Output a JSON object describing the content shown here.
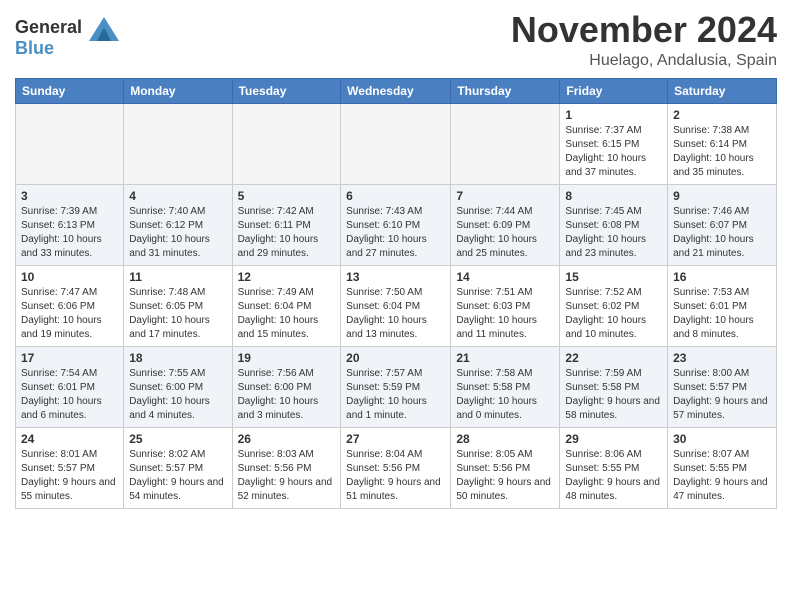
{
  "header": {
    "logo_line1": "General",
    "logo_line2": "Blue",
    "month_title": "November 2024",
    "location": "Huelago, Andalusia, Spain"
  },
  "weekdays": [
    "Sunday",
    "Monday",
    "Tuesday",
    "Wednesday",
    "Thursday",
    "Friday",
    "Saturday"
  ],
  "weeks": [
    [
      {
        "day": "",
        "info": ""
      },
      {
        "day": "",
        "info": ""
      },
      {
        "day": "",
        "info": ""
      },
      {
        "day": "",
        "info": ""
      },
      {
        "day": "",
        "info": ""
      },
      {
        "day": "1",
        "info": "Sunrise: 7:37 AM\nSunset: 6:15 PM\nDaylight: 10 hours and 37 minutes."
      },
      {
        "day": "2",
        "info": "Sunrise: 7:38 AM\nSunset: 6:14 PM\nDaylight: 10 hours and 35 minutes."
      }
    ],
    [
      {
        "day": "3",
        "info": "Sunrise: 7:39 AM\nSunset: 6:13 PM\nDaylight: 10 hours and 33 minutes."
      },
      {
        "day": "4",
        "info": "Sunrise: 7:40 AM\nSunset: 6:12 PM\nDaylight: 10 hours and 31 minutes."
      },
      {
        "day": "5",
        "info": "Sunrise: 7:42 AM\nSunset: 6:11 PM\nDaylight: 10 hours and 29 minutes."
      },
      {
        "day": "6",
        "info": "Sunrise: 7:43 AM\nSunset: 6:10 PM\nDaylight: 10 hours and 27 minutes."
      },
      {
        "day": "7",
        "info": "Sunrise: 7:44 AM\nSunset: 6:09 PM\nDaylight: 10 hours and 25 minutes."
      },
      {
        "day": "8",
        "info": "Sunrise: 7:45 AM\nSunset: 6:08 PM\nDaylight: 10 hours and 23 minutes."
      },
      {
        "day": "9",
        "info": "Sunrise: 7:46 AM\nSunset: 6:07 PM\nDaylight: 10 hours and 21 minutes."
      }
    ],
    [
      {
        "day": "10",
        "info": "Sunrise: 7:47 AM\nSunset: 6:06 PM\nDaylight: 10 hours and 19 minutes."
      },
      {
        "day": "11",
        "info": "Sunrise: 7:48 AM\nSunset: 6:05 PM\nDaylight: 10 hours and 17 minutes."
      },
      {
        "day": "12",
        "info": "Sunrise: 7:49 AM\nSunset: 6:04 PM\nDaylight: 10 hours and 15 minutes."
      },
      {
        "day": "13",
        "info": "Sunrise: 7:50 AM\nSunset: 6:04 PM\nDaylight: 10 hours and 13 minutes."
      },
      {
        "day": "14",
        "info": "Sunrise: 7:51 AM\nSunset: 6:03 PM\nDaylight: 10 hours and 11 minutes."
      },
      {
        "day": "15",
        "info": "Sunrise: 7:52 AM\nSunset: 6:02 PM\nDaylight: 10 hours and 10 minutes."
      },
      {
        "day": "16",
        "info": "Sunrise: 7:53 AM\nSunset: 6:01 PM\nDaylight: 10 hours and 8 minutes."
      }
    ],
    [
      {
        "day": "17",
        "info": "Sunrise: 7:54 AM\nSunset: 6:01 PM\nDaylight: 10 hours and 6 minutes."
      },
      {
        "day": "18",
        "info": "Sunrise: 7:55 AM\nSunset: 6:00 PM\nDaylight: 10 hours and 4 minutes."
      },
      {
        "day": "19",
        "info": "Sunrise: 7:56 AM\nSunset: 6:00 PM\nDaylight: 10 hours and 3 minutes."
      },
      {
        "day": "20",
        "info": "Sunrise: 7:57 AM\nSunset: 5:59 PM\nDaylight: 10 hours and 1 minute."
      },
      {
        "day": "21",
        "info": "Sunrise: 7:58 AM\nSunset: 5:58 PM\nDaylight: 10 hours and 0 minutes."
      },
      {
        "day": "22",
        "info": "Sunrise: 7:59 AM\nSunset: 5:58 PM\nDaylight: 9 hours and 58 minutes."
      },
      {
        "day": "23",
        "info": "Sunrise: 8:00 AM\nSunset: 5:57 PM\nDaylight: 9 hours and 57 minutes."
      }
    ],
    [
      {
        "day": "24",
        "info": "Sunrise: 8:01 AM\nSunset: 5:57 PM\nDaylight: 9 hours and 55 minutes."
      },
      {
        "day": "25",
        "info": "Sunrise: 8:02 AM\nSunset: 5:57 PM\nDaylight: 9 hours and 54 minutes."
      },
      {
        "day": "26",
        "info": "Sunrise: 8:03 AM\nSunset: 5:56 PM\nDaylight: 9 hours and 52 minutes."
      },
      {
        "day": "27",
        "info": "Sunrise: 8:04 AM\nSunset: 5:56 PM\nDaylight: 9 hours and 51 minutes."
      },
      {
        "day": "28",
        "info": "Sunrise: 8:05 AM\nSunset: 5:56 PM\nDaylight: 9 hours and 50 minutes."
      },
      {
        "day": "29",
        "info": "Sunrise: 8:06 AM\nSunset: 5:55 PM\nDaylight: 9 hours and 48 minutes."
      },
      {
        "day": "30",
        "info": "Sunrise: 8:07 AM\nSunset: 5:55 PM\nDaylight: 9 hours and 47 minutes."
      }
    ]
  ]
}
